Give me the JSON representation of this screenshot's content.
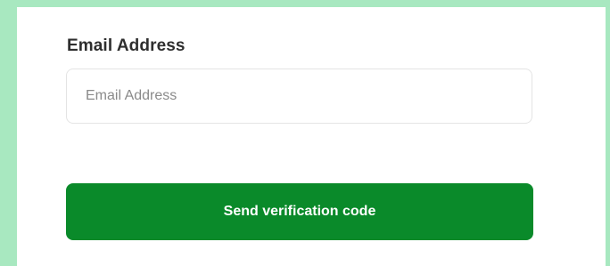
{
  "form": {
    "email_label": "Email Address",
    "email_value": "",
    "email_placeholder": "Email Address",
    "submit_label": "Send verification code"
  },
  "colors": {
    "page_background": "#a8e8c0",
    "card_background": "#ffffff",
    "button_background": "#0a8a2a",
    "button_text": "#ffffff",
    "label_text": "#2e2e2e",
    "placeholder_text": "#8a8a8a"
  }
}
